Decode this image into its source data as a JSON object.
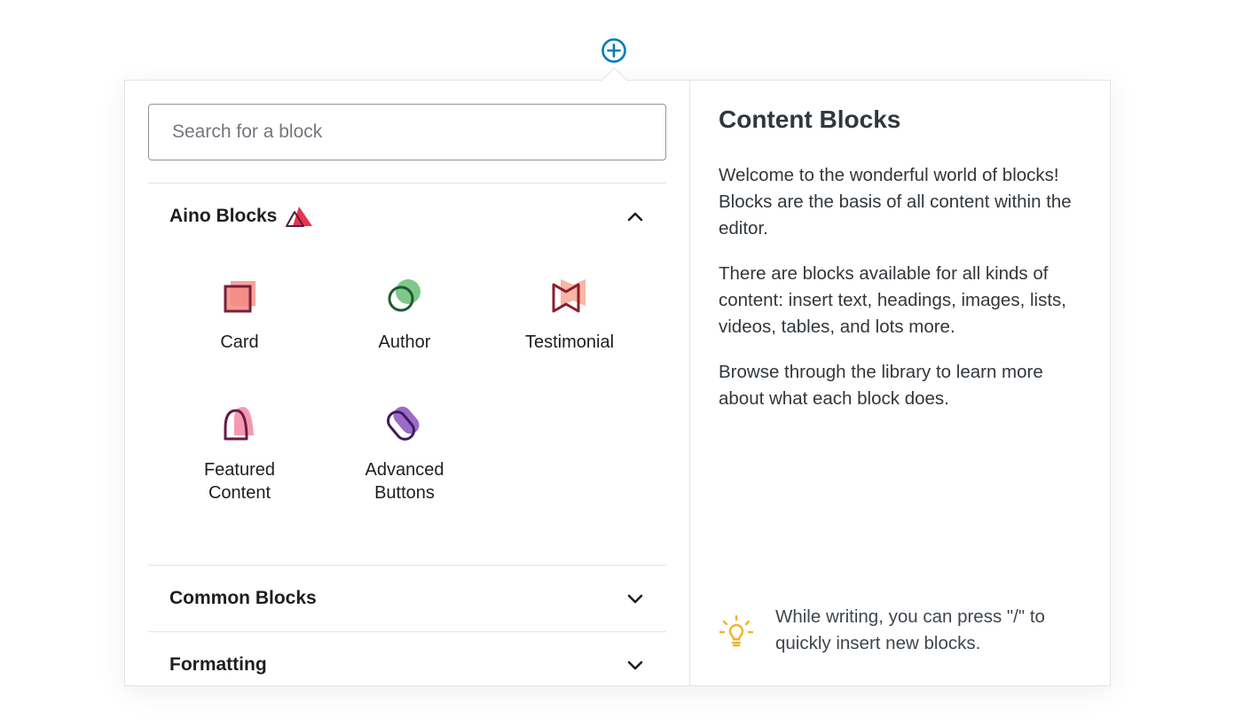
{
  "inserter": {
    "toggle_icon": "plus-circle-icon",
    "accent_color": "#007cba"
  },
  "search": {
    "placeholder": "Search for a block",
    "value": ""
  },
  "panels": {
    "aino": {
      "title": "Aino Blocks",
      "logo_icon": "aino-triangles-icon",
      "state": "expanded",
      "blocks": [
        {
          "label": "Card",
          "icon": "card-icon"
        },
        {
          "label": "Author",
          "icon": "author-icon"
        },
        {
          "label": "Testimonial",
          "icon": "testimonial-icon"
        },
        {
          "label": "Featured Content",
          "icon": "featured-content-icon"
        },
        {
          "label": "Advanced Buttons",
          "icon": "advanced-buttons-icon"
        }
      ]
    },
    "common": {
      "title": "Common Blocks",
      "state": "collapsed"
    },
    "formatting": {
      "title": "Formatting",
      "state": "collapsed"
    }
  },
  "help": {
    "title": "Content Blocks",
    "paragraphs": [
      "Welcome to the wonderful world of blocks! Blocks are the basis of all content within the editor.",
      "There are blocks available for all kinds of content: insert text, headings, images, lists, videos, tables, and lots more.",
      "Browse through the library to learn more about what each block does."
    ],
    "tip": "While writing, you can press \"/\" to quickly insert new blocks.",
    "tip_icon": "lightbulb-icon"
  }
}
